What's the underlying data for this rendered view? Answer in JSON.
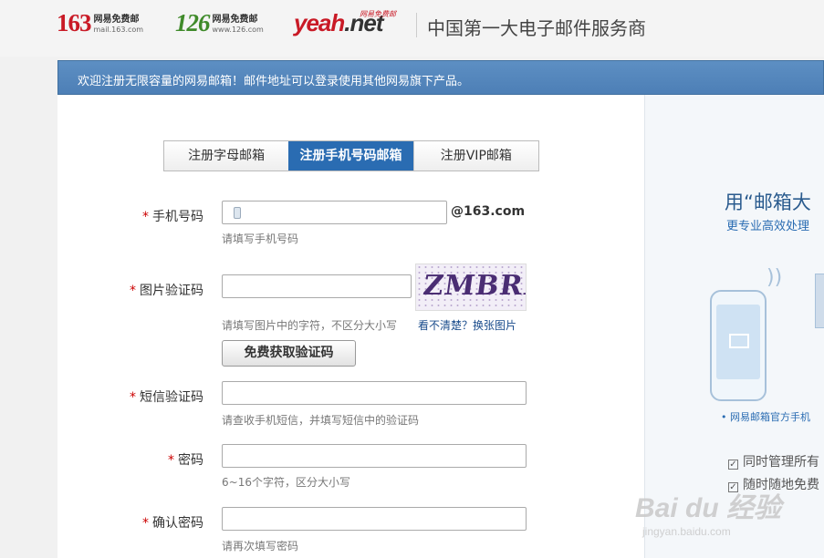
{
  "header": {
    "logos": [
      {
        "big": "163",
        "line1": "网易免费邮",
        "line2": "mail.163.com"
      },
      {
        "big": "126",
        "line1": "网易免费邮",
        "line2": "www.126.com"
      },
      {
        "big_main": "yeah",
        "big_tail": ".net",
        "tag": "网易免费邮"
      }
    ],
    "slogan": "中国第一大电子邮件服务商"
  },
  "banner": {
    "text": "欢迎注册无限容量的网易邮箱！邮件地址可以登录使用其他网易旗下产品。"
  },
  "tabs": [
    {
      "label": "注册字母邮箱",
      "active": false
    },
    {
      "label": "注册手机号码邮箱",
      "active": true
    },
    {
      "label": "注册VIP邮箱",
      "active": false
    }
  ],
  "form": {
    "required_mark": "*",
    "phone": {
      "label": "手机号码",
      "value": "",
      "suffix": "@163.com",
      "hint": "请填写手机号码"
    },
    "captcha": {
      "label": "图片验证码",
      "value": "",
      "hint": "请填写图片中的字符，不区分大小写",
      "image_text": "ZMBRK",
      "link": "看不清楚？换张图片"
    },
    "sms_button": "免费获取验证码",
    "sms": {
      "label": "短信验证码",
      "value": "",
      "hint": "请查收手机短信，并填写短信中的验证码"
    },
    "password": {
      "label": "密码",
      "value": "",
      "hint": "6~16个字符，区分大小写"
    },
    "confirm": {
      "label": "确认密码",
      "value": "",
      "hint": "请再次填写密码"
    }
  },
  "promo": {
    "title": "用“邮箱大",
    "subtitle": "更专业高效处理",
    "official": "• 网易邮箱官方手机",
    "checks": [
      "同时管理所有",
      "随时随地免费"
    ]
  },
  "watermark": {
    "brand": "Bai du 经验",
    "url": "jingyan.baidu.com"
  },
  "colors": {
    "accent": "#2a6cb2",
    "banner": "#5585bb",
    "brand_red": "#c91a26",
    "brand_green": "#3f8a2a",
    "required": "#cc0000"
  }
}
